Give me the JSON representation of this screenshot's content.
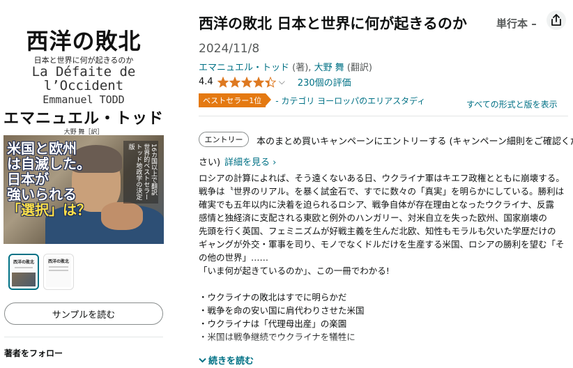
{
  "book": {
    "cover": {
      "title": "西洋の敗北",
      "subtitle": "日本と世界に何が起きるのか",
      "french_line1": "La Défaite de",
      "french_line2": "l’Occident",
      "author_en": "Emmanuel TODD",
      "author_ja": "エマニュエル・トッド",
      "translator": "大野 舞［訳］",
      "catch_lines": [
        "米国と欧州",
        "は自滅した。",
        "日本が",
        "強いられる",
        "「選択」は？"
      ],
      "badge": "16カ国以上で翻訳 世界的ベストセラー トッド地政学の決定版"
    },
    "thumbs": [
      {
        "title": "西洋の敗北",
        "selected": true
      },
      {
        "title": "西洋の敗北",
        "selected": false
      }
    ],
    "sample_button": "サンプルを読む",
    "follow_authors": "著者をフォロー"
  },
  "product": {
    "title": "西洋の敗北 日本と世界に何が起きるのか",
    "format": "単行本 –",
    "date": "2024/11/8",
    "author_link": "エマニュエル・トッド",
    "author_role": "(著),",
    "translator_link": "大野 舞",
    "translator_role": "(翻訳)",
    "rating": "4.4",
    "rating_value": 4.4,
    "rating_count": "230個の評価",
    "bestseller_badge": "ベストセラー1位",
    "bestseller_category": "- カテゴリ ヨーロッパのエリアスタディ",
    "all_formats": "すべての形式と版を表示",
    "star_color": "#de7921",
    "link_color": "#007185"
  },
  "campaign": {
    "entry_button": "エントリー",
    "text_line1": "本のまとめ買いキャンペーンにエントリーする (キャンペーン細則をご確認くだ",
    "text_line2": "さい)",
    "details_link": "詳細を見る ›"
  },
  "description": {
    "lines": [
      "ロシアの計算によれば、そう遠くないある日、ウクライナ軍はキエフ政権とともに崩壊する。",
      "戦争は〝世界のリアル〟を暴く試金石で、すでに数々の「真実」を明らかにしている。勝利は",
      "確実でも五年以内に決着を迫られるロシア、戦争自体が存在理由となったウクライナ、反露",
      "感情と独経済に支配される東欧と例外のハンガリー、対米自立を失った欧州、国家崩壊の",
      "先頭を行く英国、フェミニズムが好戦主義を生んだ北欧、知性もモラルも欠いた学歴だけの",
      "ギャングが外交・軍事を司り、モノでなくドルだけを生産する米国、ロシアの勝利を望む「そ",
      "の他の世界」……",
      "「いま何が起きているのか」、この一冊でわかる!",
      "",
      "・ウクライナの敗北はすでに明らかだ",
      "・戦争を命の安い国に肩代わりさせた米国",
      "・ウクライナは「代理母出産」の楽園",
      "・米国は戦争継続でウクライナを犠牲に"
    ],
    "read_more": "続きを読む"
  }
}
